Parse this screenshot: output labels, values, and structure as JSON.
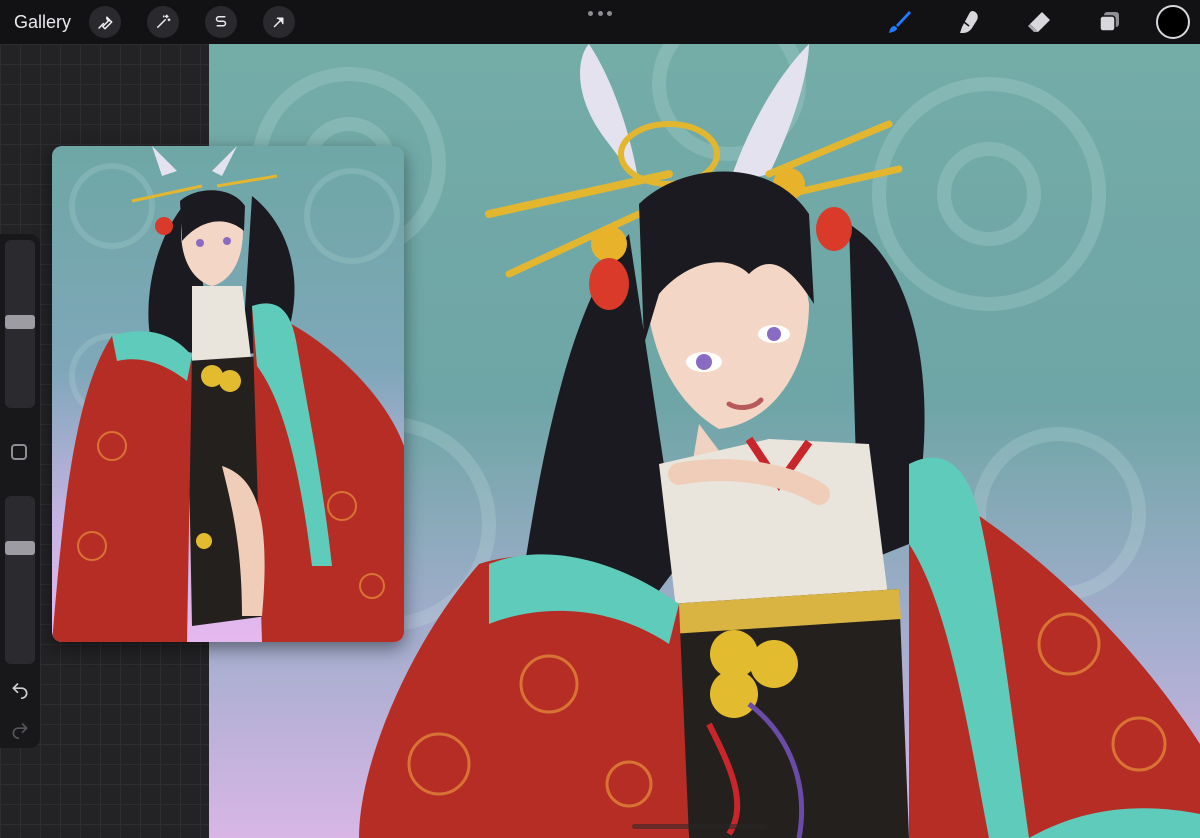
{
  "toolbar": {
    "gallery_label": "Gallery",
    "left_tools": [
      {
        "name": "actions",
        "icon": "wrench-icon"
      },
      {
        "name": "adjustments",
        "icon": "magic-wand-icon"
      },
      {
        "name": "selection",
        "icon": "selection-s-icon"
      },
      {
        "name": "transform",
        "icon": "arrow-cursor-icon"
      }
    ],
    "more_icon": "ellipsis-icon",
    "right_tools": [
      {
        "name": "brush",
        "icon": "brush-icon",
        "active": true,
        "color": "#1f7bff"
      },
      {
        "name": "smudge",
        "icon": "smudge-finger-icon",
        "active": false
      },
      {
        "name": "eraser",
        "icon": "eraser-icon",
        "active": false
      },
      {
        "name": "layers",
        "icon": "layers-icon",
        "active": false
      }
    ],
    "current_color": "#000000"
  },
  "sidebar": {
    "brush_size_level": 0.55,
    "opacity_level": 0.3,
    "modify_icon": "square-modify-icon",
    "undo_icon": "undo-arrow-icon",
    "redo_icon": "redo-arrow-icon"
  },
  "canvas": {
    "subject": "illustration",
    "background_top": "#74aca8",
    "background_bottom": "#d8b6e6"
  },
  "reference": {
    "subject": "illustration"
  }
}
